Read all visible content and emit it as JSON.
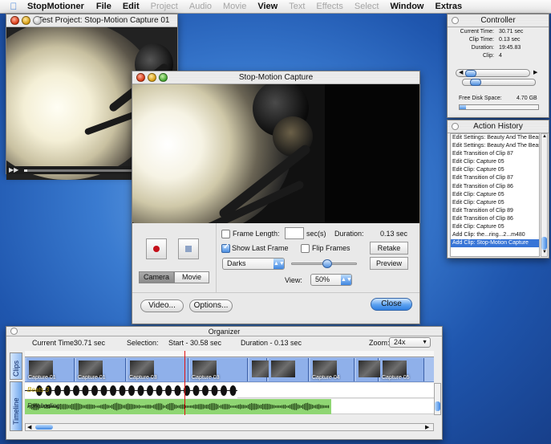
{
  "menubar": {
    "app_name": "StopMotioner",
    "items": [
      {
        "label": "File",
        "enabled": true
      },
      {
        "label": "Edit",
        "enabled": true
      },
      {
        "label": "Project",
        "enabled": false
      },
      {
        "label": "Audio",
        "enabled": false
      },
      {
        "label": "Movie",
        "enabled": false
      },
      {
        "label": "View",
        "enabled": true
      },
      {
        "label": "Text",
        "enabled": false
      },
      {
        "label": "Effects",
        "enabled": false
      },
      {
        "label": "Select",
        "enabled": false
      },
      {
        "label": "Window",
        "enabled": true
      },
      {
        "label": "Extras",
        "enabled": true
      }
    ]
  },
  "project_window": {
    "title": "Test Project: Stop-Motion Capture 01",
    "playback_progress": 0.02
  },
  "capture_window": {
    "title": "Stop-Motion Capture",
    "frame_length_label": "Frame Length:",
    "frame_length_value": "",
    "frame_length_unit": "sec(s)",
    "duration_label": "Duration:",
    "duration_value": "0.13 sec",
    "show_last_frame_label": "Show Last Frame",
    "show_last_frame_checked": true,
    "frame_length_checked": false,
    "flip_frames_label": "Flip Frames",
    "flip_frames_checked": false,
    "retake_label": "Retake",
    "preview_label": "Preview",
    "darks_select": "Darks",
    "view_label": "View:",
    "view_select": "50%",
    "opacity_slider": 0.55,
    "camera_tab": "Camera",
    "movie_tab": "Movie",
    "video_button": "Video...",
    "options_button": "Options...",
    "close_button": "Close"
  },
  "controller": {
    "title": "Controller",
    "current_time_label": "Current Time:",
    "current_time": "30.71 sec",
    "clip_time_label": "Clip Time:",
    "clip_time": "0.13 sec",
    "duration_label": "Duration:",
    "duration": "19:45.83",
    "clip_label": "Clip:",
    "clip": "4",
    "free_disk_label": "Free Disk Space:",
    "free_disk": "4.70 GB",
    "free_disk_used_fraction": 0.08
  },
  "history": {
    "title": "Action History",
    "items": [
      "Edit Settings: Beauty And The Beast",
      "Edit Settings: Beauty And The Beast",
      "Edit Transition of Clip 87",
      "Edit Clip: Capture 05",
      "Edit Clip: Capture 05",
      "Edit Transition of Clip 87",
      "Edit Transition of Clip 86",
      "Edit Clip: Capture 05",
      "Edit Clip: Capture 05",
      "Edit Transition of Clip 89",
      "Edit Transition of Clip 86",
      "Edit Clip: Capture 05",
      "Add Clip: the...ring...2...m480",
      "Add Clip: Stop-Motion Capture"
    ],
    "selected_index": 13
  },
  "organizer": {
    "title": "Organizer",
    "current_time_label": "Current Time:",
    "current_time": "30.71 sec",
    "selection_label": "Selection:",
    "selection_value": "Start - 30.58 sec",
    "duration_value": "Duration - 0.13 sec",
    "zoom_label": "Zoom:",
    "zoom_value": "24x",
    "clips_tab": "Clips",
    "timeline_tab": "Timeline",
    "clips": [
      {
        "label": "Capture 01"
      },
      {
        "label": "Capture 01"
      },
      {
        "label": "Capture 03"
      },
      {
        "label": "Capture 03"
      },
      {
        "label": ""
      },
      {
        "label": ""
      },
      {
        "label": "Capture 04"
      },
      {
        "label": ""
      },
      {
        "label": "Capture 05"
      }
    ],
    "audio_tracks": [
      {
        "label": "Beats 3"
      },
      {
        "label": "Foreboding"
      }
    ]
  }
}
